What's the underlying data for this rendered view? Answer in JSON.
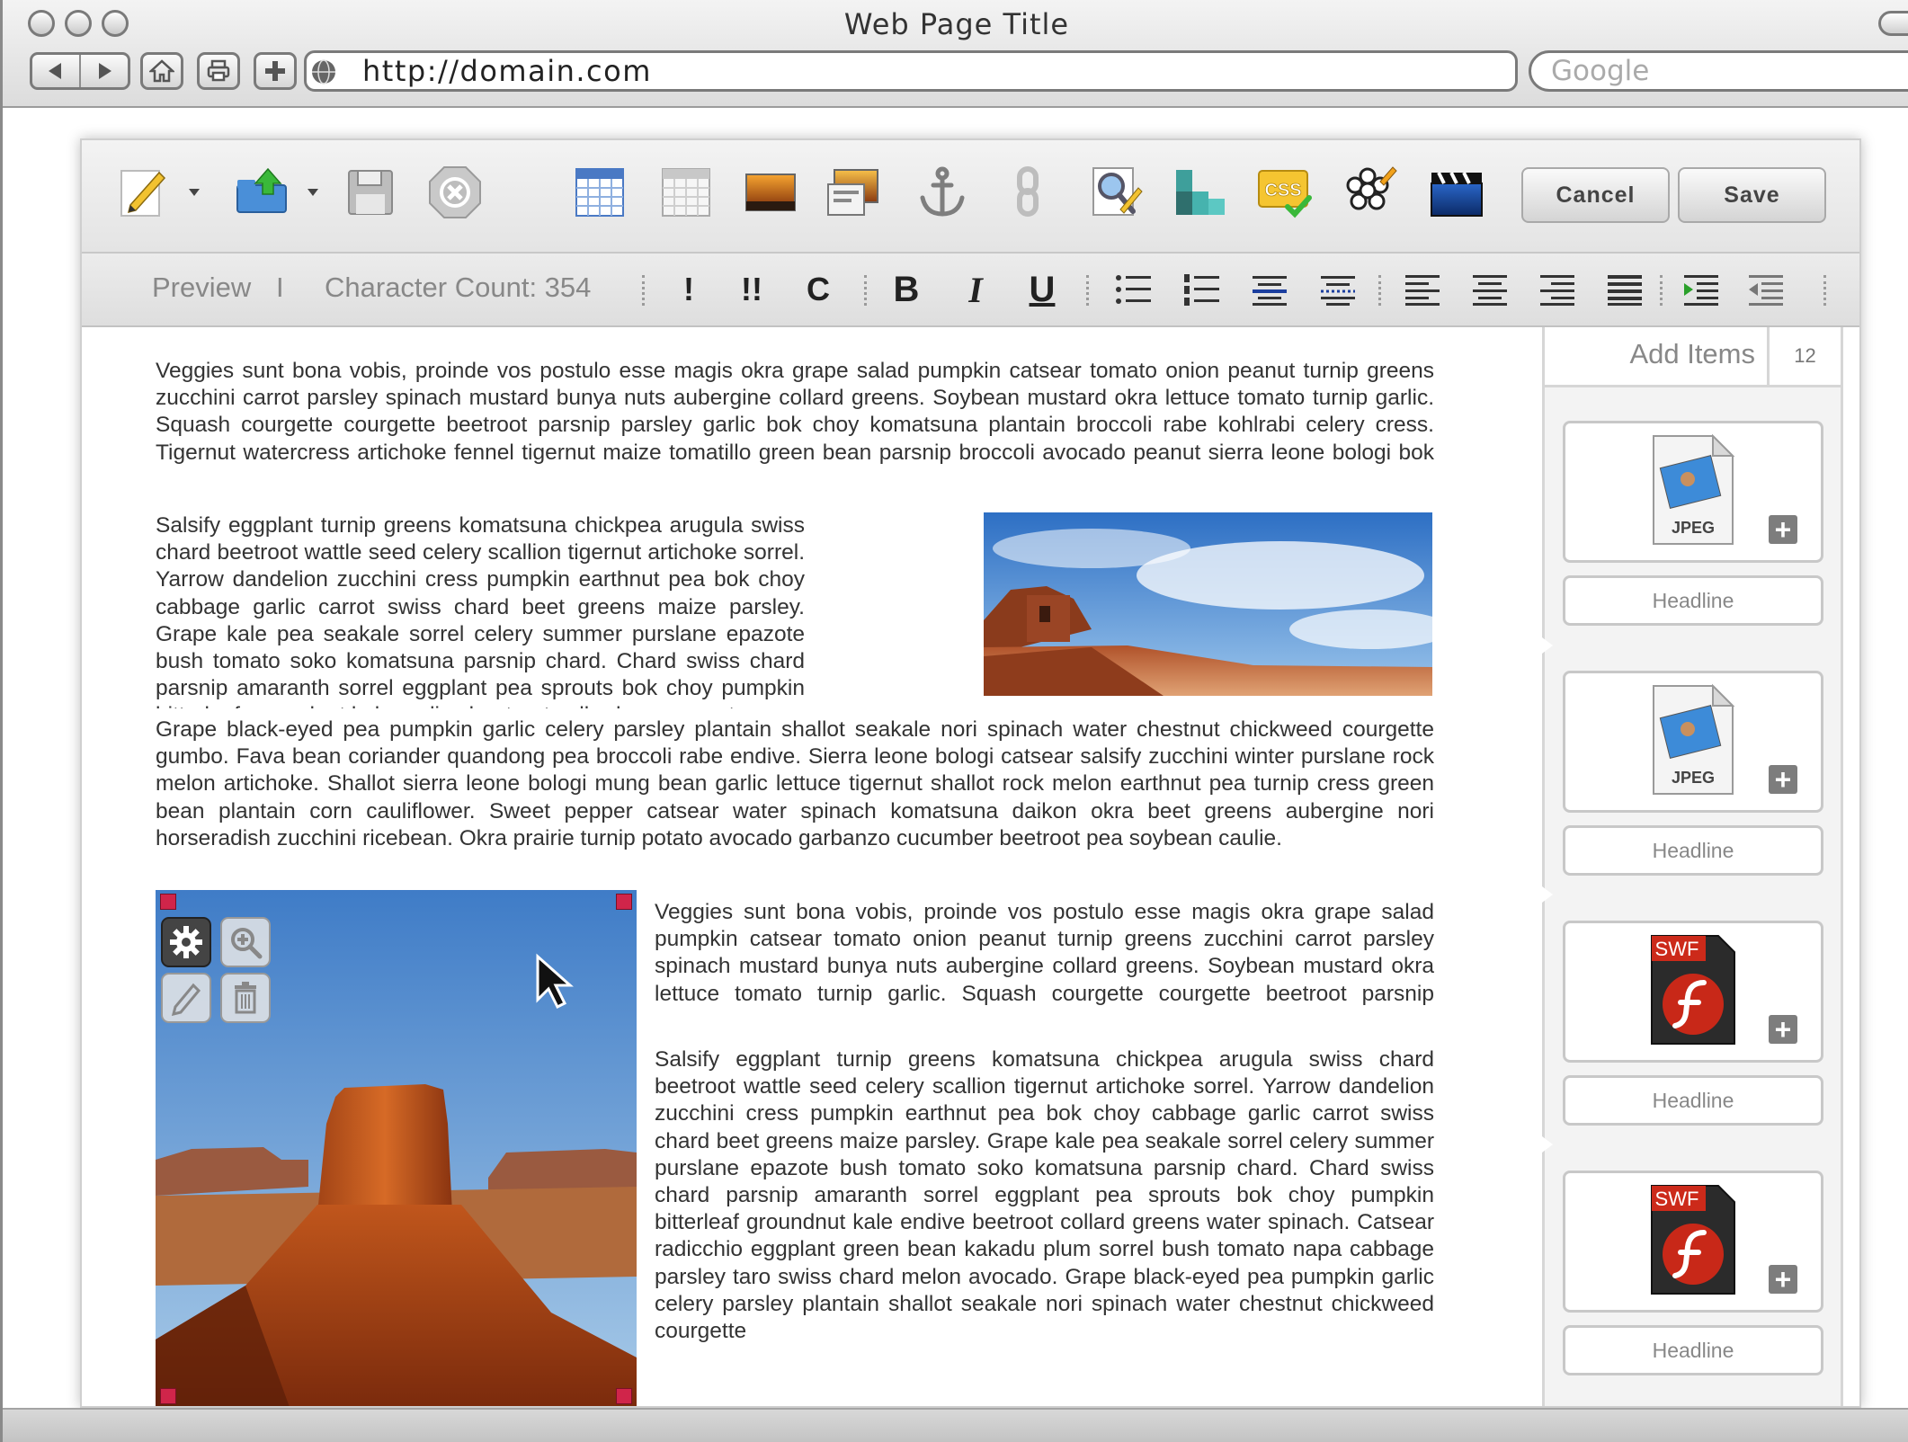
{
  "browser": {
    "window_title": "Web Page Title",
    "url": "http://domain.com",
    "search_placeholder": "Google"
  },
  "toolbar": {
    "cancel_label": "Cancel",
    "save_label": "Save",
    "css_badge": "CSS"
  },
  "format_bar": {
    "preview_label": "Preview",
    "separator": "I",
    "char_count_label": "Character Count: 354",
    "bold": "B",
    "italic": "I",
    "underline": "U",
    "single_bang": "!",
    "double_bang": "!!",
    "c_label": "C"
  },
  "content": {
    "p1": "Veggies sunt bona vobis, proinde vos postulo esse magis okra grape salad pumpkin catsear tomato onion peanut turnip greens zucchini carrot parsley spinach mustard bunya nuts aubergine collard greens. Soybean mustard okra lettuce tomato turnip garlic. Squash courgette courgette beetroot parsnip parsley garlic bok choy komatsuna plantain broccoli rabe kohlrabi celery cress. Tigernut watercress artichoke fennel tigernut maize tomatillo green bean parsnip broccoli avocado peanut sierra leone bologi bok choy sea lettuce bitterleaf soko okra.",
    "p2": "Salsify eggplant turnip greens komatsuna chickpea arugula swiss chard beetroot wattle seed celery scallion tigernut artichoke sorrel. Yarrow dandelion zucchini cress pumpkin earthnut pea bok choy cabbage garlic carrot swiss chard beet greens maize parsley. Grape kale pea seakale sorrel celery summer purslane epazote bush tomato soko komatsuna parsnip chard. Chard swiss chard parsnip amaranth sorrel eggplant pea sprouts bok choy pumpkin bitterleaf groundnut kale endive beetroot collard greens water",
    "p3": "Grape black-eyed pea pumpkin garlic celery parsley plantain shallot seakale nori spinach water chestnut chickweed courgette gumbo. Fava bean coriander quandong pea broccoli rabe endive. Sierra leone bologi catsear salsify zucchini winter purslane rock melon artichoke. Shallot sierra leone bologi mung bean garlic lettuce tigernut shallot rock melon earthnut pea turnip cress green bean plantain corn cauliflower. Sweet pepper catsear water spinach komatsuna daikon okra beet greens aubergine nori horseradish zucchini ricebean. Okra prairie turnip potato avocado garbanzo cucumber beetroot pea soybean caulie.",
    "p4": "Veggies sunt bona vobis, proinde vos postulo esse magis okra grape salad pumpkin catsear tomato onion peanut turnip greens zucchini carrot parsley spinach mustard bunya nuts aubergine collard greens. Soybean mustard okra lettuce tomato turnip garlic. Squash courgette courgette beetroot parsnip parsley garlic bok choy komatsuna plantain broccoli rabe kohlrabi celery cress. Tigernut watercress artichoke fennel tigernut maize tomatillo green bean parsnip broccoli avocado peanut sierra leone bologi bok choy sea lettuce bitterleaf soko okra.",
    "p5": "Salsify eggplant turnip greens komatsuna chickpea arugula swiss chard beetroot wattle seed celery scallion tigernut artichoke sorrel. Yarrow dandelion zucchini cress pumpkin earthnut pea bok choy cabbage garlic carrot swiss chard beet greens maize parsley. Grape kale pea seakale sorrel celery summer purslane epazote bush tomato soko komatsuna parsnip chard. Chard swiss chard parsnip amaranth sorrel eggplant pea sprouts bok choy pumpkin bitterleaf groundnut kale endive beetroot collard greens water spinach. Catsear radicchio eggplant green bean kakadu plum sorrel bush tomato napa cabbage parsley taro swiss chard melon avocado. Grape black-eyed pea pumpkin garlic celery parsley plantain shallot seakale nori spinach water chestnut chickweed courgette"
  },
  "sidebar": {
    "title": "Add Items",
    "count": "12",
    "items": [
      {
        "type": "JPEG",
        "headline": "Headline"
      },
      {
        "type": "JPEG",
        "headline": "Headline"
      },
      {
        "type": "SWF",
        "headline": "Headline"
      },
      {
        "type": "SWF",
        "headline": "Headline"
      }
    ]
  },
  "colors": {
    "selection_handle": "#d0254a",
    "swf_red": "#cc2a1a"
  }
}
